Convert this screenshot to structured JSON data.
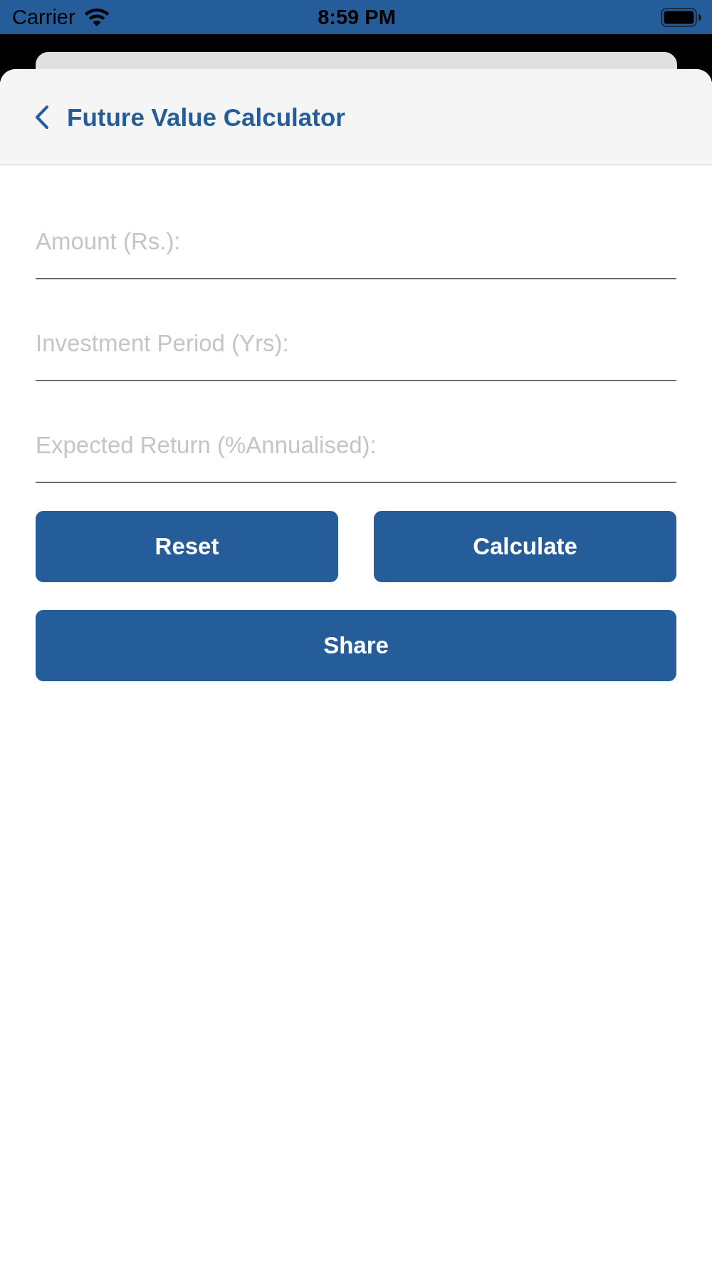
{
  "status_bar": {
    "carrier": "Carrier",
    "time": "8:59 PM"
  },
  "header": {
    "title": "Future Value Calculator"
  },
  "fields": [
    {
      "placeholder": "Amount (Rs.):"
    },
    {
      "placeholder": "Investment Period (Yrs):"
    },
    {
      "placeholder": "Expected Return (%Annualised):"
    }
  ],
  "button_rows": [
    {
      "buttons": [
        {
          "label": "Reset"
        },
        {
          "label": "Calculate"
        }
      ]
    },
    {
      "buttons": [
        {
          "label": "Share"
        }
      ]
    }
  ]
}
